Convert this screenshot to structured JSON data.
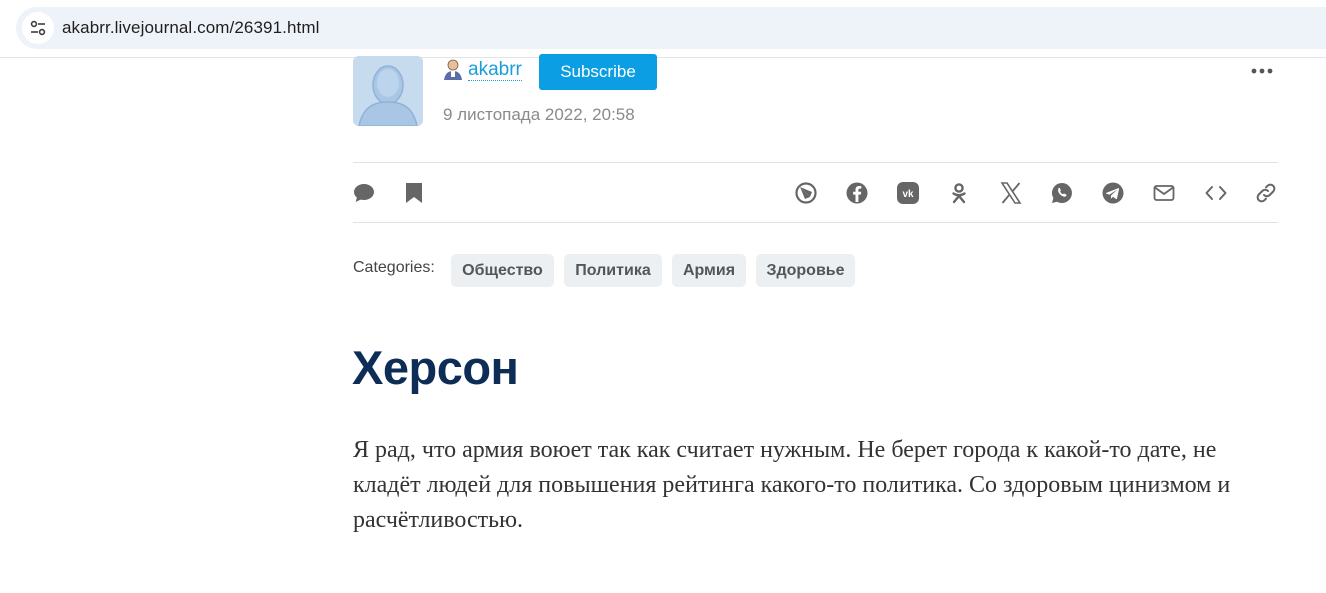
{
  "browser": {
    "url": "akabrr.livejournal.com/26391.html",
    "site_info_icon": "tune-icon"
  },
  "author": {
    "name": "akabrr",
    "subscribe_label": "Subscribe",
    "date": "9 листопада 2022, 20:58"
  },
  "toolbar": {
    "left_icons": [
      "comment-icon",
      "bookmark-icon"
    ],
    "share_icons": [
      "livejournal-icon",
      "facebook-icon",
      "vk-icon",
      "odnoklassniki-icon",
      "x-icon",
      "whatsapp-icon",
      "telegram-icon",
      "email-icon",
      "embed-icon",
      "link-icon"
    ]
  },
  "categories": {
    "label": "Categories:",
    "tags": [
      "Общество",
      "Политика",
      "Армия",
      "Здоровье"
    ]
  },
  "post": {
    "title": "Херсон",
    "body": "Я рад, что армия воюет так как считает нужным. Не берет города к какой-то дате, не кладёт людей для повышения рейтинга какого-то политика. Со здоровым цинизмом и расчётливостью."
  },
  "colors": {
    "accent": "#0b9ee2",
    "link": "#1a9ed8",
    "title": "#0d2d57",
    "icon_gray": "#666666"
  }
}
